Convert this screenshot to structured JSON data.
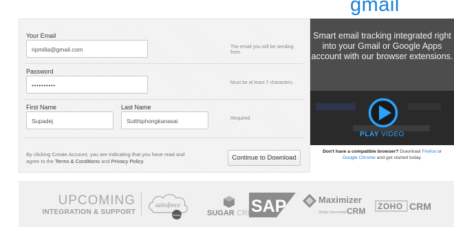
{
  "brand": {
    "gmail_word": "gmail"
  },
  "form": {
    "email": {
      "label": "Your Email",
      "value": "ripmilla@gmail.com",
      "hint": "The email you will be sending from."
    },
    "password": {
      "label": "Password",
      "value": "••••••••••",
      "hint": "Must be at least 7 characters."
    },
    "first_name": {
      "label": "First Name",
      "value": "Supadej"
    },
    "last_name": {
      "label": "Last Name",
      "value": "Sutthiphongkanasai"
    },
    "name_hint": "Required.",
    "fineprint_pre": "By clicking Create Account, you are indicating that you have read and agree to the ",
    "terms_link": "Terms & Conditions",
    "fineprint_and": " and ",
    "privacy_link": "Privacy Policy",
    "fineprint_post": ".",
    "submit_label": "Continue to Download"
  },
  "side": {
    "title": "Smart email tracking integrated right into your Gmail or Google Apps account with our browser extensions.",
    "play_label_bold": "PLAY",
    "play_label_thin": " VIDEO",
    "compat_bold": "Don't have a compatible browser?",
    "compat_text": " Download ",
    "firefox_link": "Firefox",
    "compat_or": " or ",
    "chrome_link": "Google Chrome",
    "compat_end": " and get started today."
  },
  "banner": {
    "line1": "UPCOMING",
    "line2": "INTEGRATION & SUPPORT",
    "logos": {
      "salesforce": "salesforce",
      "salesforce_sub": "Vesting",
      "sugar_a": "SUGAR",
      "sugar_b": "CRM",
      "sap": "SAP",
      "maximizer": "Maximizer",
      "maximizer_sub": "Simply Successful",
      "maximizer_crm": "CRM",
      "zoho": "ZOHO",
      "zoho_crm": "CRM"
    }
  },
  "colors": {
    "accent": "#1b7fd6",
    "play": "#2aa3ff",
    "side_bg": "#4d4d4d"
  }
}
